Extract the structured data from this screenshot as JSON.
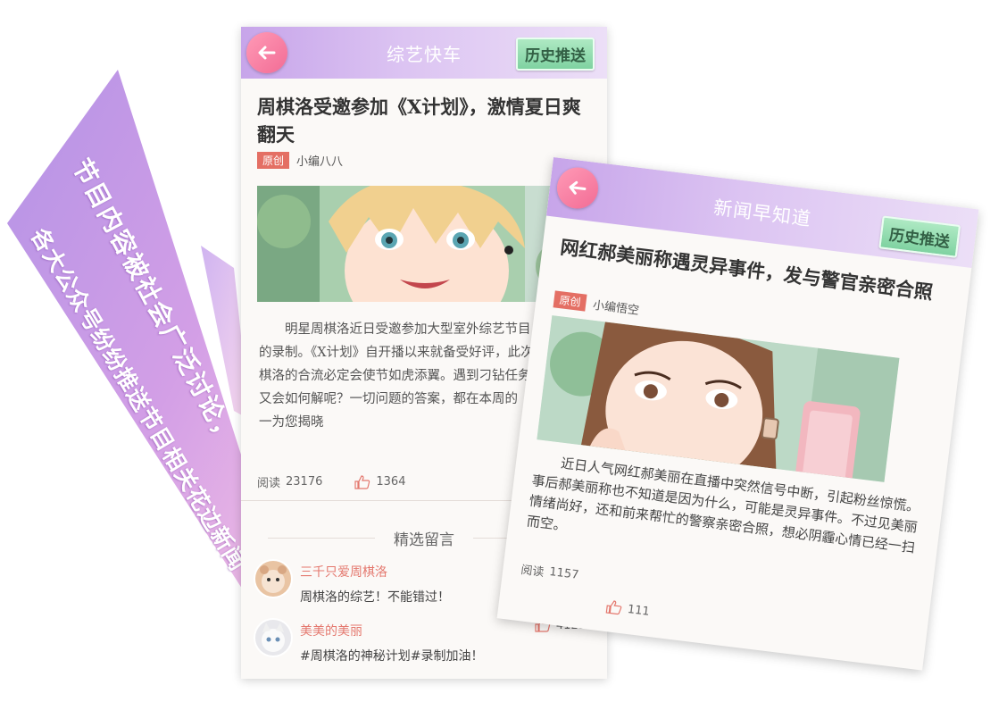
{
  "banner": {
    "line1": "节目内容被社会广泛讨论，",
    "line2": "各大公众号纷纷推送节目相关花边新闻"
  },
  "colors": {
    "banner_purple": "#c49ae6",
    "banner_pink": "#f2b9dd",
    "accent_pink": "#f26c95",
    "history_green": "#7fd2a1",
    "original_tag": "#e46f64",
    "comment_name": "#e4786e"
  },
  "icons": {
    "back": "arrow-left-icon",
    "like": "thumbs-up-icon"
  },
  "article1": {
    "header_title": "综艺快车",
    "history_label": "历史推送",
    "headline": "周棋洛受邀参加《X计划》，激情夏日爽翻天",
    "tag": "原创",
    "author": "小编八八",
    "body": "明星周棋洛近日受邀参加大型室外综艺节目《X计划》的录制。《X计划》自开播以来就备受好评，此次大明星周棋洛的合流必定会使节如虎添翼。遇到刁钻任务，周棋洛又会如何解呢？一切问题的答案，都在本周的《X计划》一为您揭晓",
    "reads_label": "阅读",
    "reads": "23176",
    "likes": "1364",
    "comments_title": "精选留言",
    "comments": [
      {
        "name": "三千只爱周棋洛",
        "text": "周棋洛的综艺！不能错过！"
      },
      {
        "name": "美美的美丽",
        "text": "#周棋洛的神秘计划#录制加油！",
        "likes": "4125"
      }
    ]
  },
  "article2": {
    "header_title": "新闻早知道",
    "history_label": "历史推送",
    "headline": "网红郝美丽称遇灵异事件，发与警官亲密合照",
    "tag": "原创",
    "author": "小编悟空",
    "body": "近日人气网红郝美丽在直播中突然信号中断，引起粉丝惊慌。事后郝美丽称也不知道是因为什么，可能是灵异事件。不过见美丽情绪尚好，还和前来帮忙的警察亲密合照，想必阴霾心情已经一扫而空。",
    "reads_label": "阅读",
    "reads": "1157",
    "likes": "111"
  }
}
